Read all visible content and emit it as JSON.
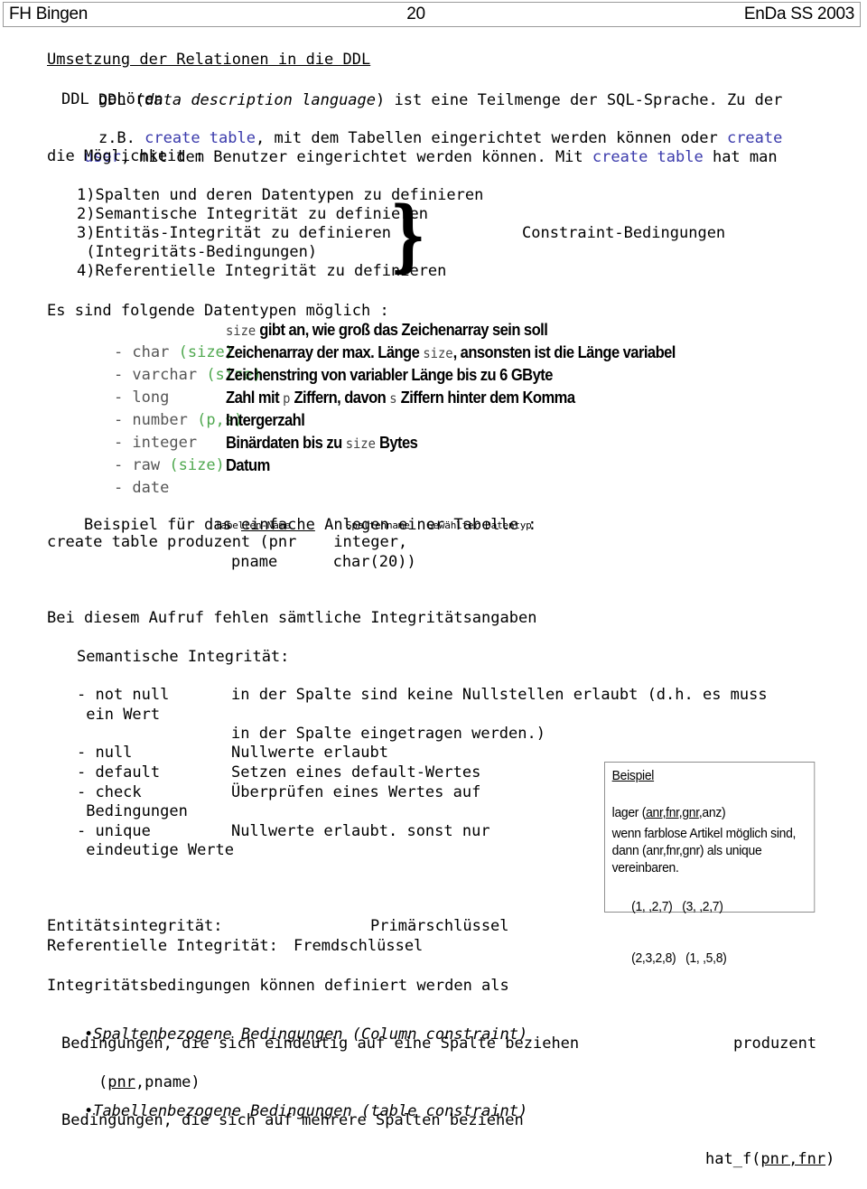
{
  "header": {
    "institution": "FH Bingen",
    "page_number": "20",
    "course": "EnDa SS 2003"
  },
  "title": "Umsetzung der Relationen in die DDL",
  "intro": {
    "line1_a": "DDL (",
    "line1_italic": "data description language",
    "line1_b": ") ist eine Teilmenge der SQL-Sprache. Zu der",
    "line2": "DDL gehören",
    "line3_a": "z.B. ",
    "line3_kw1": "create table",
    "line3_b": ", mit dem Tabellen eingerichtet werden können oder ",
    "line3_kw2": "create",
    "line4_kw": "user",
    "line4_a": ", mit dem Benutzer eingerichtet werden können. Mit ",
    "line4_kw2": "create table",
    "line4_b": " hat man",
    "line5": "die Möglichkeit :"
  },
  "numbered_list": {
    "items": [
      "1)Spalten und deren Datentypen zu definieren",
      "2)Semantische Integrität zu definieren",
      "3)Entitäs-Integrität zu definieren",
      " (Integritäts-Bedingungen)",
      "4)Referentielle Integrität zu definieren"
    ],
    "brace": "}",
    "brace_label": "Constraint-Bedingungen"
  },
  "datatypes": {
    "heading": "Es sind folgende Datentypen möglich :",
    "rows": [
      {
        "name": "- char ",
        "param": "(size)",
        "desc_pre": "size",
        "desc_mono_first": true,
        "desc_post": " gibt an, wie groß das Zeichenarray sein soll"
      },
      {
        "name": "- varchar ",
        "param": "(size)",
        "desc_pre": "Zeichenarray der max. Länge ",
        "desc_mono": "size",
        "desc_post": ", ansonsten ist die Länge variabel"
      },
      {
        "name": "- long",
        "param": "",
        "desc_pre": "Zeichenstring von variabler Länge bis zu 6 GByte",
        "desc_mono": "",
        "desc_post": ""
      },
      {
        "name": "- number ",
        "param": "(p,s)",
        "desc_pre": "Zahl mit ",
        "desc_mono": "p",
        "desc_post": " Ziffern, davon ",
        "desc_mono2": "s",
        "desc_post2": " Ziffern hinter dem Komma"
      },
      {
        "name": "- integer",
        "param": "",
        "desc_pre": "Intergerzahl",
        "desc_mono": "",
        "desc_post": ""
      },
      {
        "name": "- raw ",
        "param": "(size)",
        "desc_pre": "Binärdaten bis zu ",
        "desc_mono": "size",
        "desc_post": " Bytes"
      },
      {
        "name": "- date",
        "param": "",
        "desc_pre": "Datum",
        "desc_mono": "",
        "desc_post": ""
      }
    ]
  },
  "example_create": {
    "heading_a": "Beispiel für das ",
    "heading_ul": "einfache",
    "heading_b": " Anlegen einer Tabelle :",
    "annot_table": "Tabellen-Name",
    "annot_column": "Spaltenname",
    "annot_type": "Gewählter Datentyp",
    "code_line1": "create table produzent (pnr    integer,",
    "code_line2": "pname      char(20))"
  },
  "semantic": {
    "note": "Bei diesem Aufruf fehlen sämtliche Integritätsangaben",
    "heading": "Semantische Integrität:",
    "rows": [
      {
        "key": "- not null",
        "text": "in der Spalte sind keine Nullstellen erlaubt (d.h. es muss"
      },
      {
        "key": " ein Wert",
        "text": ""
      },
      {
        "key": "",
        "text": "in der Spalte eingetragen werden.)"
      },
      {
        "key": "- null",
        "text": "Nullwerte erlaubt"
      },
      {
        "key": "- default",
        "text": "Setzen eines default-Wertes"
      },
      {
        "key": "- check",
        "text": "Überprüfen eines Wertes auf"
      },
      {
        "key": " Bedingungen",
        "text": ""
      },
      {
        "key": "- unique",
        "text": "Nullwerte erlaubt. sonst nur"
      },
      {
        "key": " eindeutige Werte",
        "text": ""
      }
    ]
  },
  "callout": {
    "title": "Beispiel",
    "relation_pre": "lager (",
    "relation_ul": "anr,fnr,gnr",
    "relation_post": ",anz)",
    "note_line1": "wenn farblose Artikel möglich sind,",
    "note_line2": "dann (anr,fnr,gnr) als unique",
    "note_line3": "vereinbaren.",
    "tuples": [
      {
        "left": "(1, ,2,7)",
        "right": "(3, ,2,7)"
      },
      {
        "left": "(2,3,2,8)",
        "right": "(1, ,5,8)"
      }
    ]
  },
  "integrity": {
    "entity_label": "Entitätsintegrität:",
    "entity_value": "Primärschlüssel",
    "ref_label": "Referentielle Integrität:",
    "ref_value": "Fremdschlüssel"
  },
  "constraints": {
    "heading": "Integritätsbedingungen können definiert werden als",
    "bullet1": "Spaltenbezogene Bedingungen (Column constraint)",
    "bullet1_text": "Bedingungen, die sich eindeutig auf eine Spalte beziehen",
    "bullet1_right": "produzent",
    "bullet1_sub_pre": "(",
    "bullet1_sub_ul": "pnr",
    "bullet1_sub_post": ",pname)",
    "bullet2": "Tabellenbezogene Bedingungen (table constraint)",
    "bullet2_text": "Bedingungen, die sich auf mehrere Spalten beziehen",
    "bullet2_right_pre": "hat_f(",
    "bullet2_right_ul": "pnr,fnr",
    "bullet2_right_post": ")",
    "bullet_glyph": "•"
  }
}
